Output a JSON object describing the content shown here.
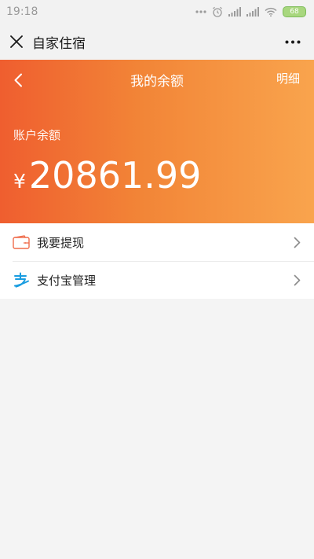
{
  "status_bar": {
    "time": "19:18",
    "battery": "68"
  },
  "title_bar": {
    "title": "自家住宿"
  },
  "balance_page": {
    "title": "我的余额",
    "detail_label": "明细",
    "account_label": "账户余额",
    "currency_symbol": "¥",
    "amount": "20861.99"
  },
  "menu": {
    "items": [
      {
        "label": "我要提现",
        "icon": "wallet-icon"
      },
      {
        "label": "支付宝管理",
        "icon": "alipay-icon"
      }
    ]
  },
  "colors": {
    "hero_gradient_start": "#ef5e2f",
    "hero_gradient_end": "#f9a44d",
    "wallet_icon": "#ef6b4a",
    "alipay_icon": "#1a9de0"
  }
}
